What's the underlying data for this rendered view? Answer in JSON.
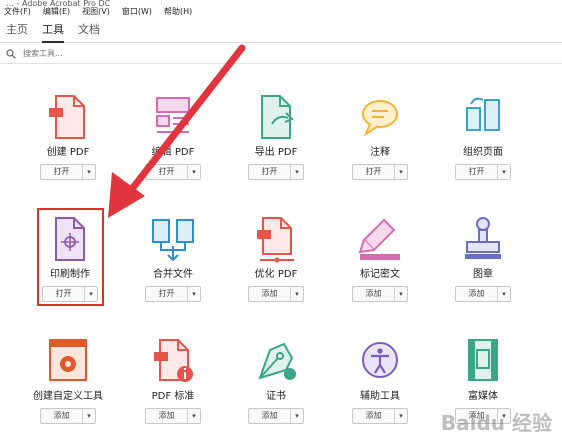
{
  "titlebar": {
    "text": "… - Adobe Acrobat Pro DC"
  },
  "menu": [
    "文件(F)",
    "编辑(E)",
    "视图(V)",
    "窗口(W)",
    "帮助(H)"
  ],
  "tabs": [
    "主页",
    "工具",
    "文档"
  ],
  "active_tab": "工具",
  "search": {
    "placeholder": "搜索工具..."
  },
  "tools": [
    {
      "label": "创建 PDF",
      "button": "打开",
      "icon": "create-pdf-icon",
      "color": "#e8534a"
    },
    {
      "label": "编辑 PDF",
      "button": "打开",
      "icon": "edit-pdf-icon",
      "color": "#d56bb0"
    },
    {
      "label": "导出 PDF",
      "button": "打开",
      "icon": "export-pdf-icon",
      "color": "#3aa688"
    },
    {
      "label": "注释",
      "button": "打开",
      "icon": "comment-icon",
      "color": "#f2b531"
    },
    {
      "label": "组织页面",
      "button": "打开",
      "icon": "organize-pages-icon",
      "color": "#3fa3c7"
    },
    {
      "label": "印刷制作",
      "button": "打开",
      "icon": "print-production-icon",
      "color": "#8d5aa8"
    },
    {
      "label": "合并文件",
      "button": "打开",
      "icon": "combine-files-icon",
      "color": "#2d8fd1"
    },
    {
      "label": "优化 PDF",
      "button": "添加",
      "icon": "optimize-pdf-icon",
      "color": "#e8534a"
    },
    {
      "label": "标记密文",
      "button": "添加",
      "icon": "redact-icon",
      "color": "#d56bb0"
    },
    {
      "label": "图章",
      "button": "添加",
      "icon": "stamp-icon",
      "color": "#6b6fc4"
    },
    {
      "label": "创建自定义工具",
      "button": "添加",
      "icon": "custom-tool-icon",
      "color": "#e05a2e"
    },
    {
      "label": "PDF 标准",
      "button": "添加",
      "icon": "pdf-standards-icon",
      "color": "#e8534a"
    },
    {
      "label": "证书",
      "button": "添加",
      "icon": "certificate-icon",
      "color": "#3aa688"
    },
    {
      "label": "辅助工具",
      "button": "添加",
      "icon": "accessibility-icon",
      "color": "#7a5cbf"
    },
    {
      "label": "富媒体",
      "button": "添加",
      "icon": "rich-media-icon",
      "color": "#3aa688"
    }
  ],
  "watermark": "Baidu 经验"
}
